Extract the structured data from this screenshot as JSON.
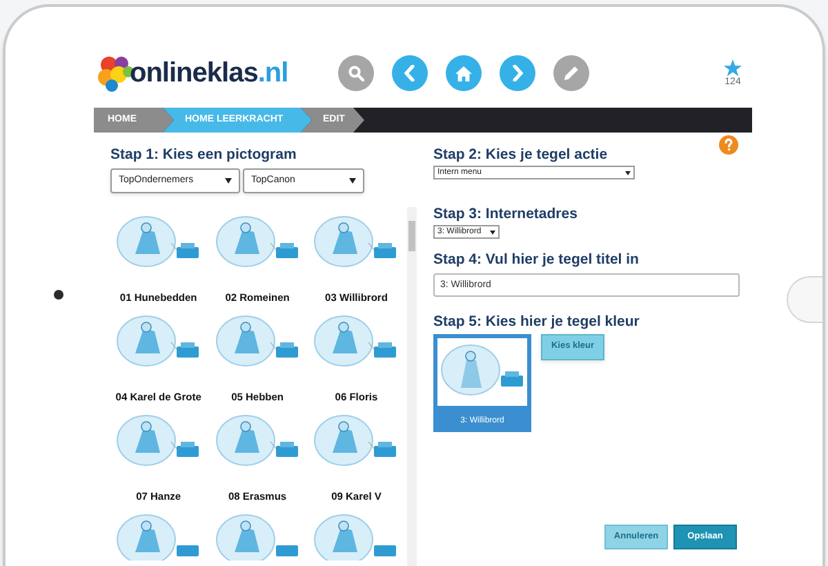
{
  "header": {
    "logo": {
      "name": "onlineklas",
      "suffix": ".nl"
    },
    "nav_buttons": [
      {
        "kind": "search",
        "disabled": true
      },
      {
        "kind": "back",
        "disabled": false
      },
      {
        "kind": "home",
        "disabled": false
      },
      {
        "kind": "forward",
        "disabled": false
      },
      {
        "kind": "edit",
        "disabled": true
      }
    ],
    "favorites": {
      "count": "124"
    }
  },
  "breadcrumb": [
    {
      "label": "HOME",
      "selected": false
    },
    {
      "label": "HOME LEERKRACHT",
      "selected": true
    },
    {
      "label": "EDIT",
      "selected": false
    }
  ],
  "step1": {
    "title": "Stap 1: Kies een pictogram",
    "selects": [
      {
        "value": "TopOndernemers"
      },
      {
        "value": "TopCanon"
      }
    ],
    "pictograms": [
      {
        "label": "01 Hunebedden",
        "cut_off": false
      },
      {
        "label": "02 Romeinen",
        "cut_off": false
      },
      {
        "label": "03 Willibrord",
        "cut_off": false
      },
      {
        "label": "04 Karel de Grote",
        "cut_off": false
      },
      {
        "label": "05 Hebben",
        "cut_off": false
      },
      {
        "label": "06 Floris",
        "cut_off": false
      },
      {
        "label": "07 Hanze",
        "cut_off": false
      },
      {
        "label": "08 Erasmus",
        "cut_off": false
      },
      {
        "label": "09 Karel V",
        "cut_off": false
      },
      {
        "cut_off": true
      },
      {
        "cut_off": true
      },
      {
        "cut_off": true
      }
    ]
  },
  "step2": {
    "title": "Stap 2: Kies je tegel actie",
    "select": {
      "value": "Intern menu"
    }
  },
  "step3": {
    "title": "Stap 3: Internetadres",
    "select": {
      "value": "3: Willibrord"
    }
  },
  "step4": {
    "title": "Stap 4: Vul hier je tegel titel in",
    "input": {
      "value": "3: Willibrord"
    }
  },
  "step5": {
    "title": "Stap 5: Kies hier je tegel kleur",
    "preview": {
      "label": "3: Willibrord"
    },
    "button": "Kies kleur"
  },
  "actions": [
    {
      "label": "Annuleren",
      "kind": "secondary"
    },
    {
      "label": "Opslaan",
      "kind": "primary"
    }
  ]
}
